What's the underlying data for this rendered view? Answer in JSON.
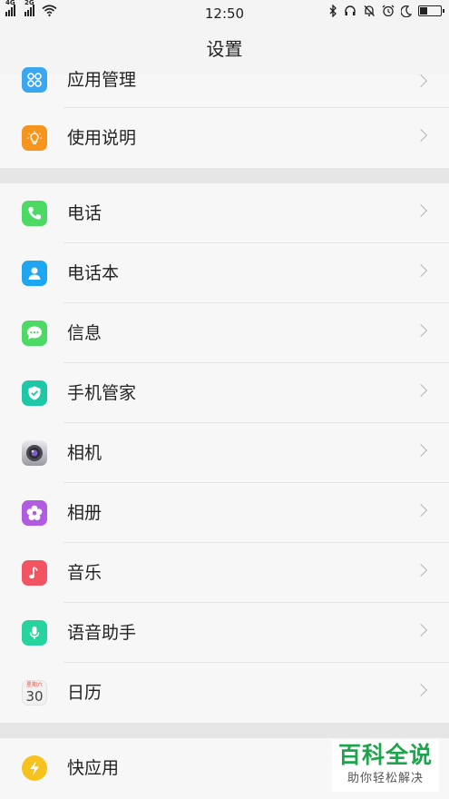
{
  "status_bar": {
    "time": "12:50",
    "sim1_label": "4G",
    "sim2_label": "2G",
    "icons": [
      "signal-icon",
      "wifi-icon",
      "bluetooth-icon",
      "headset-icon",
      "mute-icon",
      "alarm-icon",
      "moon-icon",
      "battery-icon"
    ]
  },
  "header": {
    "title": "设置"
  },
  "sections": [
    {
      "items": [
        {
          "label": "应用管理",
          "icon": "app-manage-icon",
          "color": "#3aa7f0"
        },
        {
          "label": "使用说明",
          "icon": "bulb-icon",
          "color": "#f7941d"
        }
      ]
    },
    {
      "items": [
        {
          "label": "电话",
          "icon": "phone-icon",
          "color": "#4cd964"
        },
        {
          "label": "电话本",
          "icon": "contacts-icon",
          "color": "#1fa6f1"
        },
        {
          "label": "信息",
          "icon": "message-icon",
          "color": "#4cd964"
        },
        {
          "label": "手机管家",
          "icon": "shield-icon",
          "color": "#1dc8a6"
        },
        {
          "label": "相机",
          "icon": "camera-icon",
          "color": "#9a9aa3"
        },
        {
          "label": "相册",
          "icon": "flower-icon",
          "color": "#b05ce0"
        },
        {
          "label": "音乐",
          "icon": "music-icon",
          "color": "#f25561"
        },
        {
          "label": "语音助手",
          "icon": "microphone-icon",
          "color": "#27d39e"
        },
        {
          "label": "日历",
          "icon": "calendar-icon",
          "color": "#f2f2f2",
          "weekday": "星期六",
          "day": "30"
        }
      ]
    },
    {
      "items": [
        {
          "label": "快应用",
          "icon": "lightning-icon",
          "color": "#f7c21d"
        }
      ]
    }
  ],
  "watermark": {
    "title": "百科全说",
    "subtitle": "助你轻松解决"
  }
}
